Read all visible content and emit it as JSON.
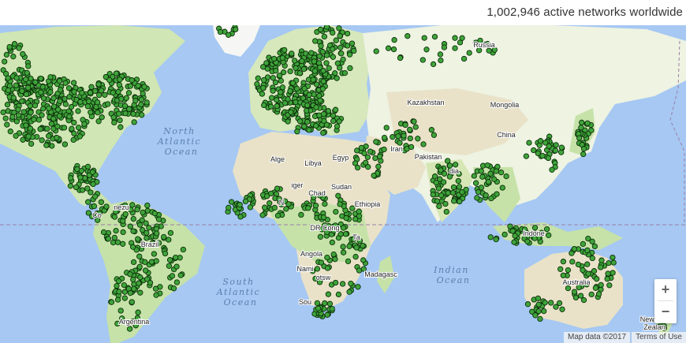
{
  "header": {
    "network_count": "1,002,946 active networks worldwide"
  },
  "map": {
    "ocean_labels": {
      "north_atlantic": [
        "North",
        "Atlantic",
        "Ocean"
      ],
      "south_atlantic": [
        "South",
        "Atlantic",
        "Ocean"
      ],
      "indian": [
        "Indian",
        "Ocean"
      ]
    },
    "country_labels": {
      "russia": "Russia",
      "kazakhstan": "Kazakhstan",
      "mongolia": "Mongolia",
      "china": "China",
      "iran": "Iran",
      "pakistan": "Pakistan",
      "india": "dia",
      "algeria": "Alge",
      "libya": "Libya",
      "egypt": "Egyp",
      "sudan": "Sudan",
      "niger": "iger",
      "chad": "Chad",
      "nigeria": "N",
      "ethiopia": "Ethiopia",
      "dr_congo": "DR Cong",
      "tanzania": "Ta",
      "angola": "Angola",
      "namibia": "Nami",
      "botswana": "otsw",
      "madagascar": "Madagasc",
      "south_africa": "Sou",
      "brazil": "Brazil",
      "argentina": "Argentina",
      "venezuela": "nezu",
      "colombia": "Co",
      "indonesia": "Indone",
      "australia": "Australia",
      "new_zealand": [
        "New",
        "Zealan"
      ]
    },
    "controls": {
      "zoom_in": "+",
      "zoom_out": "−"
    },
    "attribution": {
      "map_data": "Map data ©2017",
      "terms": "Terms of Use"
    },
    "colors": {
      "ocean": "#a6c8f3",
      "land": "#f2efe4",
      "forest": "#c6e2a8",
      "desert": "#e9e2c8",
      "ice": "#f6f6f4",
      "marker_fill": "#3fa43a",
      "marker_stroke": "#0c2d0a",
      "equator": "#9a7fa6",
      "ocean_text": "#5a7fae"
    }
  }
}
